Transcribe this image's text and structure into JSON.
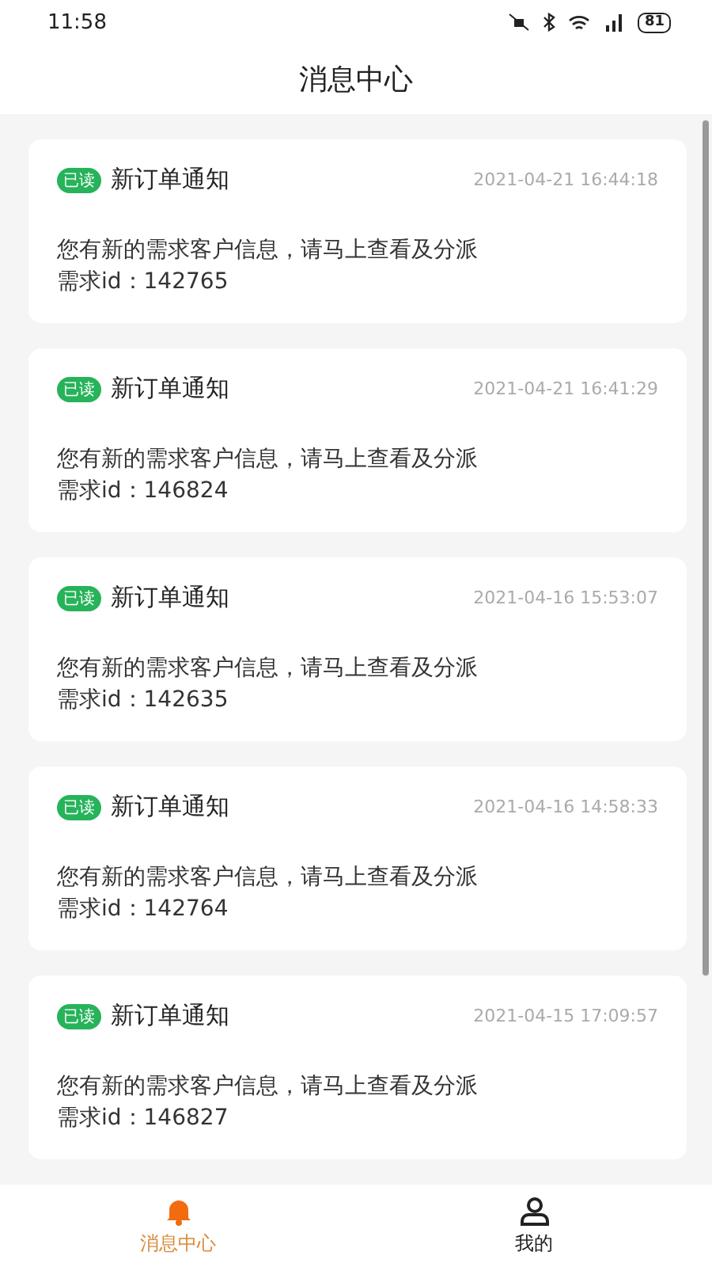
{
  "status_bar": {
    "time": "11:58",
    "battery": "81"
  },
  "header": {
    "title": "消息中心"
  },
  "messages": [
    {
      "badge": "已读",
      "read": true,
      "title": "新订单通知",
      "time": "2021-04-21 16:44:18",
      "body": "您有新的需求客户信息，请马上查看及分派",
      "id_line": "需求id：142765"
    },
    {
      "badge": "已读",
      "read": true,
      "title": "新订单通知",
      "time": "2021-04-21 16:41:29",
      "body": "您有新的需求客户信息，请马上查看及分派",
      "id_line": "需求id：146824"
    },
    {
      "badge": "已读",
      "read": true,
      "title": "新订单通知",
      "time": "2021-04-16 15:53:07",
      "body": "您有新的需求客户信息，请马上查看及分派",
      "id_line": "需求id：142635"
    },
    {
      "badge": "已读",
      "read": true,
      "title": "新订单通知",
      "time": "2021-04-16 14:58:33",
      "body": "您有新的需求客户信息，请马上查看及分派",
      "id_line": "需求id：142764"
    },
    {
      "badge": "已读",
      "read": true,
      "title": "新订单通知",
      "time": "2021-04-15 17:09:57",
      "body": "您有新的需求客户信息，请马上查看及分派",
      "id_line": "需求id：146827"
    }
  ],
  "tabs": [
    {
      "kind": "bell",
      "label": "消息中心",
      "selected": true
    },
    {
      "kind": "person",
      "label": "我的",
      "selected": false
    }
  ]
}
